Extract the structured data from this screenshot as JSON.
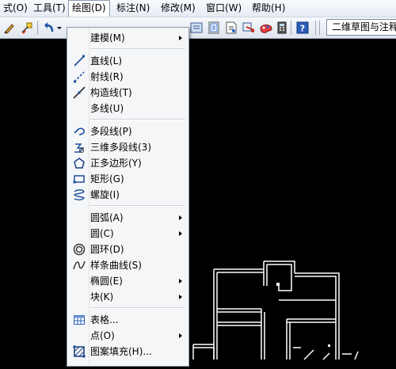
{
  "menubar": {
    "items": [
      {
        "label": "式(O)"
      },
      {
        "label": "工具(T)"
      },
      {
        "label": "绘图(D)"
      },
      {
        "label": "标注(N)"
      },
      {
        "label": "修改(M)"
      },
      {
        "label": "窗口(W)"
      },
      {
        "label": "帮助(H)"
      }
    ]
  },
  "toolbar": {
    "workspace_value": "二维草图与注释"
  },
  "menu": {
    "items": [
      {
        "label": "建模(M)",
        "icon": "none",
        "submenu": true
      },
      {
        "label": "直线(L)",
        "icon": "line-icon"
      },
      {
        "label": "射线(R)",
        "icon": "ray-icon"
      },
      {
        "label": "构造线(T)",
        "icon": "construction-line-icon"
      },
      {
        "label": "多线(U)",
        "icon": "none"
      },
      {
        "label": "多段线(P)",
        "icon": "polyline-icon"
      },
      {
        "label": "三维多段线(3)",
        "icon": "3d-polyline-icon"
      },
      {
        "label": "正多边形(Y)",
        "icon": "polygon-icon"
      },
      {
        "label": "矩形(G)",
        "icon": "rectangle-icon"
      },
      {
        "label": "螺旋(I)",
        "icon": "helix-icon"
      },
      {
        "label": "圆弧(A)",
        "icon": "none",
        "submenu": true
      },
      {
        "label": "圆(C)",
        "icon": "none",
        "submenu": true
      },
      {
        "label": "圆环(D)",
        "icon": "donut-icon"
      },
      {
        "label": "样条曲线(S)",
        "icon": "spline-icon"
      },
      {
        "label": "椭圆(E)",
        "icon": "none",
        "submenu": true
      },
      {
        "label": "块(K)",
        "icon": "none",
        "submenu": true
      },
      {
        "label": "表格...",
        "icon": "table-icon"
      },
      {
        "label": "点(O)",
        "icon": "none",
        "submenu": true
      },
      {
        "label": "图案填充(H)...",
        "icon": "hatch-icon"
      }
    ]
  },
  "colors": {
    "canvas": "#000000",
    "drawing_lines": "#ffffff",
    "menu_bg": "#f5f6f7"
  }
}
